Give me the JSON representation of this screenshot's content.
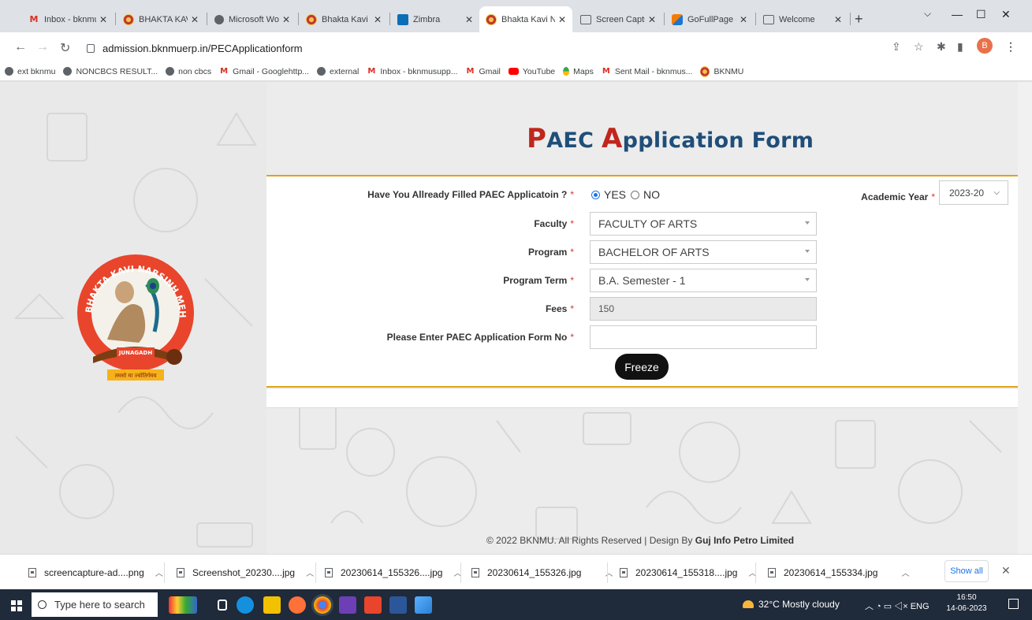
{
  "browser": {
    "tabs": [
      {
        "label": "Inbox - bknmu",
        "icon": "gmail-icon"
      },
      {
        "label": "BHAKTA KAVI N",
        "icon": "university-icon"
      },
      {
        "label": "Microsoft Word",
        "icon": "globe-icon"
      },
      {
        "label": "Bhakta Kavi Na",
        "icon": "university-icon"
      },
      {
        "label": "Zimbra",
        "icon": "zimbra-icon"
      },
      {
        "label": "Bhakta Kavi Na",
        "icon": "university-icon",
        "active": true
      },
      {
        "label": "Screen Capture",
        "icon": "screen-capture-icon"
      },
      {
        "label": "GoFullPage - F",
        "icon": "gofullpage-icon"
      },
      {
        "label": "Welcome",
        "icon": "screen-capture-icon"
      }
    ],
    "new_tab": "+",
    "url": "admission.bknmuerp.in/PECApplicationform",
    "profile_initial": "B",
    "bookmarks": [
      {
        "label": "ext bknmu",
        "icon": "globe-icon"
      },
      {
        "label": "NONCBCS RESULT...",
        "icon": "globe-icon"
      },
      {
        "label": "non cbcs",
        "icon": "globe-icon"
      },
      {
        "label": "Gmail - Googlehttp...",
        "icon": "gmail-icon"
      },
      {
        "label": "external",
        "icon": "globe-icon"
      },
      {
        "label": "Inbox - bknmusupp...",
        "icon": "gmail-icon"
      },
      {
        "label": "Gmail",
        "icon": "gmail-icon"
      },
      {
        "label": "YouTube",
        "icon": "youtube-icon"
      },
      {
        "label": "Maps",
        "icon": "maps-icon"
      },
      {
        "label": "Sent Mail - bknmus...",
        "icon": "gmail-icon"
      },
      {
        "label": "BKNMU",
        "icon": "university-icon"
      }
    ]
  },
  "page": {
    "title_p": "P",
    "title_aec": "AEC ",
    "title_a": "A",
    "title_rest": "pplication Form",
    "logo": {
      "text_arc": "BHAKTA KAVI NARSINH MEHTA UNIVERSITY",
      "city": "JUNAGADH",
      "motto": "तमसो मा ज्योतिर्गमय"
    },
    "form": {
      "filled_label": "Have You Allready Filled PAEC Applicatoin ?",
      "yes_label": "YES",
      "no_label": "NO",
      "selected": "YES",
      "year_label": "Academic Year",
      "year_value": "2023-20",
      "faculty_label": "Faculty",
      "faculty_value": "FACULTY OF ARTS",
      "program_label": "Program",
      "program_value": "BACHELOR OF ARTS",
      "term_label": "Program Term",
      "term_value": "B.A. Semester - 1",
      "fees_label": "Fees",
      "fees_value": "150",
      "formno_label": "Please Enter PAEC Application Form No",
      "formno_value": "",
      "required_mark": "*",
      "freeze_label": "Freeze"
    },
    "footer_text": "© 2022 BKNMU. All Rights Reserved | Design By ",
    "footer_company": "Guj Info Petro Limited"
  },
  "downloads": {
    "items": [
      "screencapture-ad....png",
      "Screenshot_20230....jpg",
      "20230614_155326....jpg",
      "20230614_155326.jpg",
      "20230614_155318....jpg",
      "20230614_155334.jpg"
    ],
    "show_all": "Show all"
  },
  "taskbar": {
    "search_placeholder": "Type here to search",
    "weather": "32°C  Mostly cloudy",
    "tray": "ENG",
    "time": "16:50",
    "date": "14-06-2023"
  },
  "colors": {
    "accent_red": "#c0261e",
    "title_blue": "#1f4e79",
    "gold_rule": "#e0a31a"
  }
}
